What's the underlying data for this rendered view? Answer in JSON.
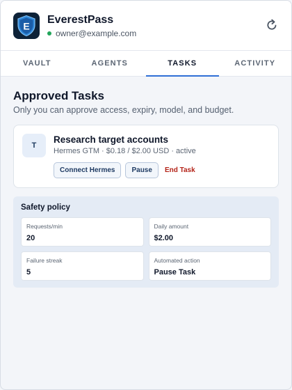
{
  "app": {
    "title": "EverestPass",
    "account": "owner@example.com",
    "logo_letter": "E",
    "status_color": "#22a55b",
    "refresh_icon": "refresh-icon"
  },
  "tabs": [
    {
      "label": "VAULT",
      "active": false
    },
    {
      "label": "AGENTS",
      "active": false
    },
    {
      "label": "TASKS",
      "active": true
    },
    {
      "label": "ACTIVITY",
      "active": false
    }
  ],
  "main": {
    "title": "Approved Tasks",
    "subtitle": "Only you can approve access, expiry, model, and budget."
  },
  "task": {
    "avatar_letter": "T",
    "title": "Research target accounts",
    "meta": "Hermes GTM · $0.18 / $2.00 USD · active",
    "actions": {
      "connect": "Connect Hermes",
      "pause": "Pause",
      "end": "End Task"
    }
  },
  "policy": {
    "title": "Safety policy",
    "items": [
      {
        "label": "Requests/min",
        "value": "20"
      },
      {
        "label": "Daily amount",
        "value": "$2.00"
      },
      {
        "label": "Failure streak",
        "value": "5"
      },
      {
        "label": "Automated action",
        "value": "Pause Task"
      }
    ]
  },
  "colors": {
    "accent": "#2f6fd6",
    "danger": "#b42318",
    "logo_bg": "#0d2238"
  }
}
